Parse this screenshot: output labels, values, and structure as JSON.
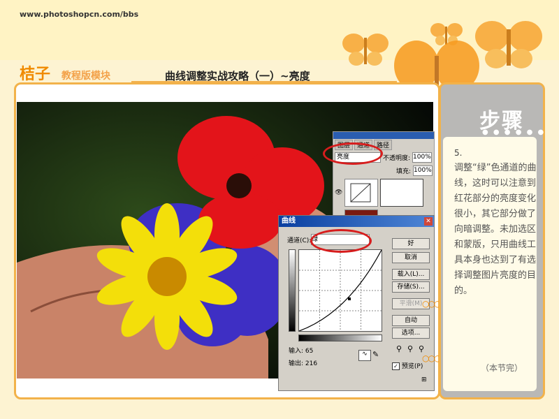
{
  "header": {
    "url": "www.photoshopcn.com/bbs",
    "brand": "桔子",
    "brand_sub": "教程版模块",
    "title": "曲线调整实战攻略（一）~亮度"
  },
  "sidebar": {
    "heading": "步骤",
    "step_number": "5.",
    "step_text": "调整“绿”色通道的曲线，这时可以注意到红花部分的亮度变化很小，其它部分做了向暗调整。未加选区和蒙版，只用曲线工具本身也达到了有选择调整图片亮度的目的。",
    "end_note": "（本节完）"
  },
  "layers_panel": {
    "tabs": [
      "图层",
      "通道",
      "路径"
    ],
    "blend_mode": "亮度",
    "opacity_label": "不透明度:",
    "opacity_value": "100%",
    "fill_label": "填充:",
    "fill_value": "100%",
    "layer_name": "背景"
  },
  "curves_dialog": {
    "title": "曲线",
    "channel_label": "通道(C):",
    "channel_value": "绿",
    "input_label": "输入:",
    "input_value": "65",
    "output_label": "输出:",
    "output_value": "216",
    "buttons": {
      "ok": "好",
      "cancel": "取消",
      "load": "载入(L)...",
      "save": "存储(S)...",
      "smooth": "平滑(M)",
      "auto": "自动",
      "options": "选项..."
    },
    "preview_label": "预览(P)",
    "preview_checked": true
  },
  "colors": {
    "accent": "#f08a00",
    "frame": "#f2b24a",
    "highlight_ring": "#d71d1d"
  }
}
